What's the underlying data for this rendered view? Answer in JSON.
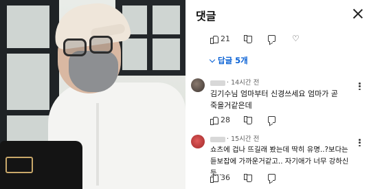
{
  "header": {
    "title": "댓글"
  },
  "top_actions": {
    "likes": "21"
  },
  "replies_button": {
    "label": "답글 5개"
  },
  "comments": [
    {
      "time": "14시간 전",
      "text_line1": "김기수님 엄마부터 신경쓰세요 엄마가 곧",
      "text_line2": "죽을거같은데",
      "likes": "28"
    },
    {
      "time": "15시간 전",
      "text_line1": "쇼츠에 겁나 뜨길래 봤는데 딱히 유명..?보다는",
      "text_line2": "듣보잡에 가까운거같고.. 자기애가 너무 강하신듯..",
      "likes": "36"
    }
  ],
  "colors": {
    "link_blue": "#065fd4",
    "text_primary": "#0f0f0f",
    "text_secondary": "#606060"
  },
  "icons": [
    "close-icon",
    "thumb-up-icon",
    "thumb-down-icon",
    "reply-icon",
    "heart-icon",
    "more-vert-icon"
  ]
}
